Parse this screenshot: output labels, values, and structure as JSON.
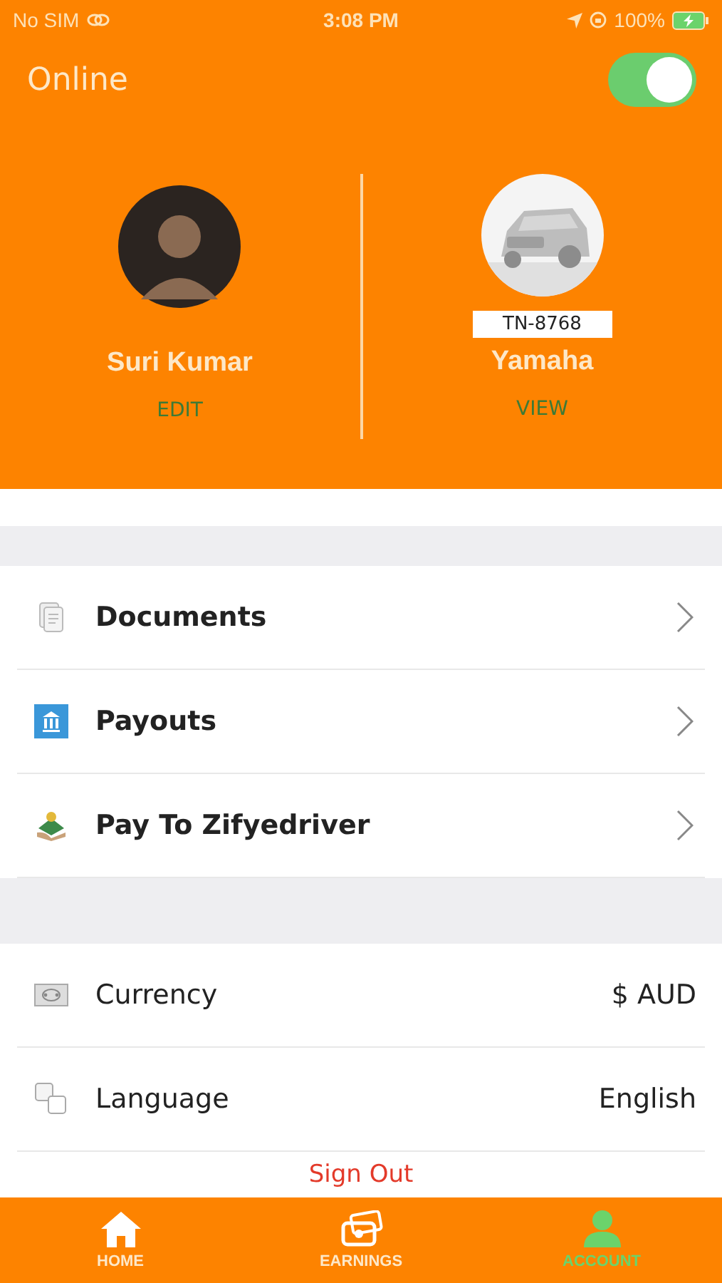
{
  "status_bar": {
    "carrier": "No SIM",
    "time": "3:08 PM",
    "battery": "100%"
  },
  "header": {
    "title": "Online",
    "online": true
  },
  "profile": {
    "name": "Suri Kumar",
    "action": "EDIT"
  },
  "vehicle": {
    "plate": "TN-8768",
    "name": "Yamaha",
    "action": "VIEW",
    "kind": "picture"
  },
  "menu": [
    {
      "label": "Documents",
      "kind": "documents"
    },
    {
      "label": "Payouts",
      "kind": "bank"
    },
    {
      "label": "Pay To Zifyedriver",
      "kind": "money"
    }
  ],
  "settings": [
    {
      "label": "Currency",
      "value": "$ AUD",
      "kind": "cash"
    },
    {
      "label": "Language",
      "value": "English",
      "kind": "language"
    }
  ],
  "sign_out": "Sign Out",
  "tabs": [
    {
      "label": "HOME",
      "kind": "home",
      "selected": false
    },
    {
      "label": "EARNINGS",
      "kind": "earnings",
      "selected": false
    },
    {
      "label": "ACCOUNT",
      "kind": "account",
      "selected": true
    }
  ]
}
